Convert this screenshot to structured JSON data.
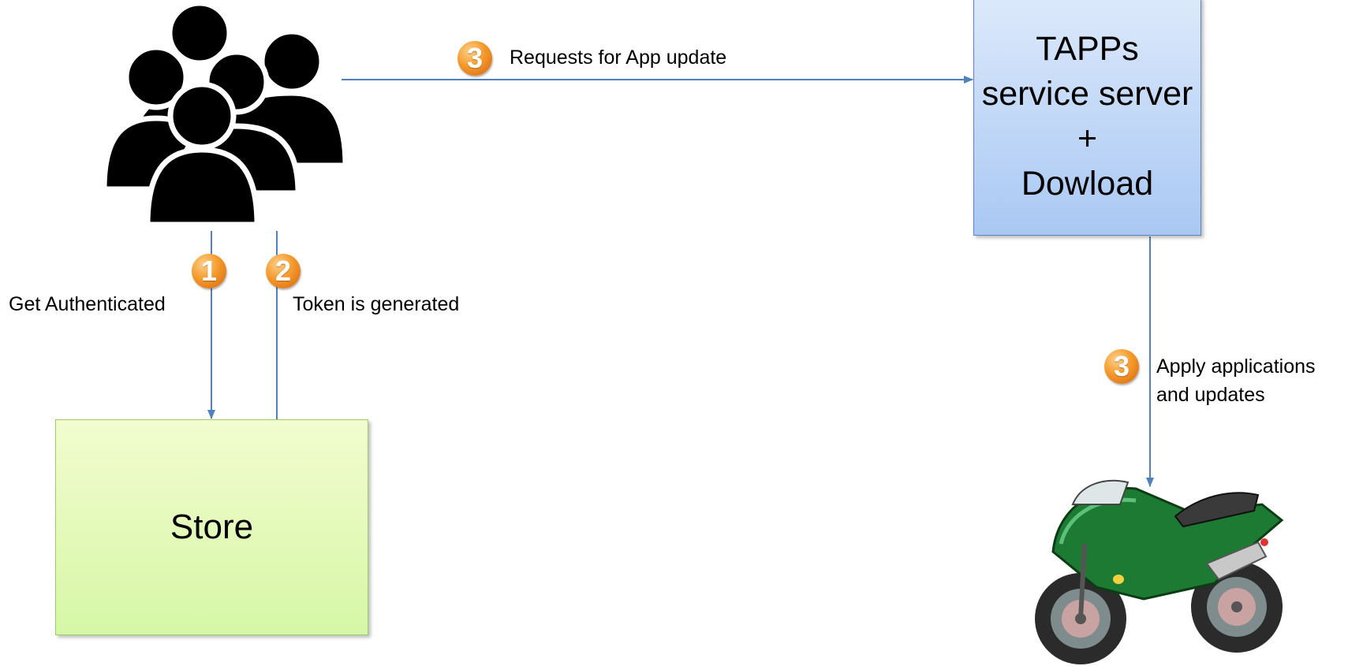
{
  "nodes": {
    "tapps_server": {
      "lines": [
        "TAPPs",
        "service server",
        "+",
        "Dowload"
      ],
      "fill_top": "#dce9fb",
      "fill_bottom": "#a9c8f3",
      "border": "#5b82c1"
    },
    "store": {
      "label": "Store",
      "fill_top": "#f2fccf",
      "fill_bottom": "#d6f7a6",
      "border": "#9ccf64"
    },
    "users": {
      "icon": "users-group-icon"
    },
    "motorcycle": {
      "icon": "motorcycle-icon"
    }
  },
  "steps": {
    "get_authenticated": {
      "badge": "1",
      "label": "Get Authenticated"
    },
    "token_generated": {
      "badge": "2",
      "label": "Token is generated"
    },
    "request_update": {
      "badge": "3",
      "label": "Requests for App update"
    },
    "apply_updates": {
      "badge": "3",
      "label_lines": [
        "Apply applications",
        "and updates"
      ]
    }
  },
  "colors": {
    "arrow": "#4f81bd",
    "badge": "#f08a1e"
  }
}
